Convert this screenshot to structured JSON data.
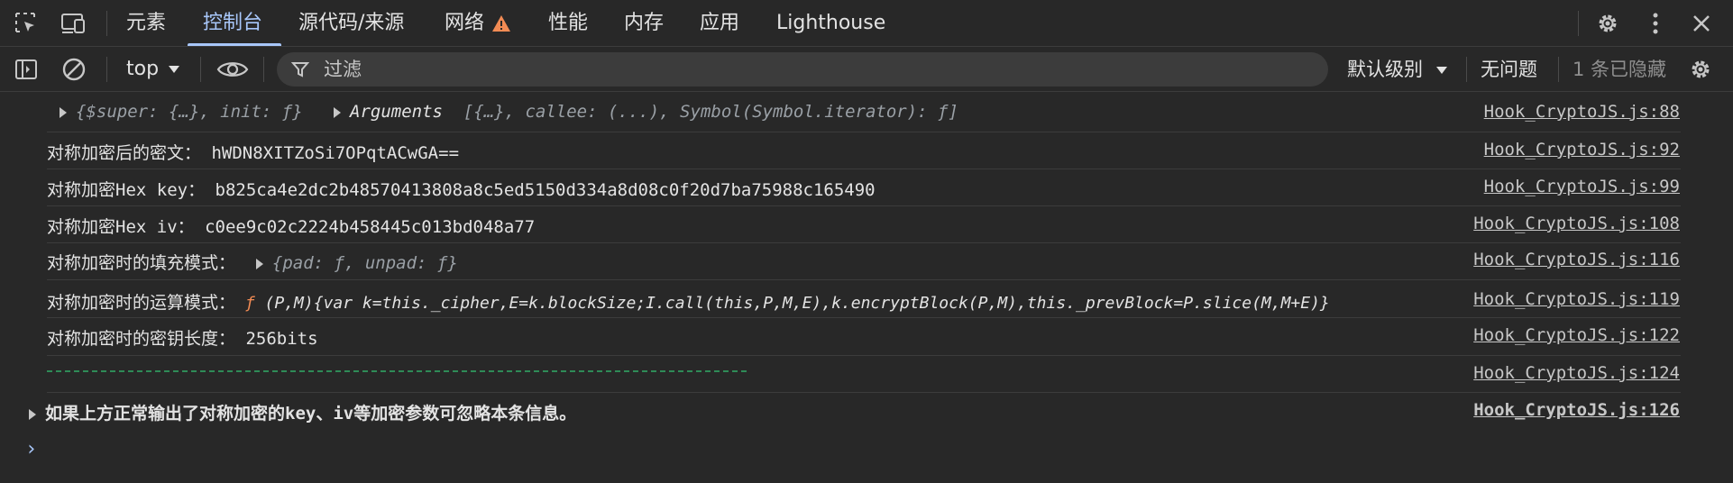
{
  "tabs": [
    {
      "label": "元素"
    },
    {
      "label": "控制台"
    },
    {
      "label": "源代码/来源"
    },
    {
      "label": "网络"
    },
    {
      "label": "性能"
    },
    {
      "label": "内存"
    },
    {
      "label": "应用"
    },
    {
      "label": "Lighthouse"
    }
  ],
  "toolbar": {
    "context": "top",
    "filter_placeholder": "过滤",
    "levels": "默认级别",
    "issues": "无问题",
    "hidden_count": "1 条已隐藏"
  },
  "colors": {
    "accent": "#a8c7fa",
    "background": "#282828",
    "warning": "#f28b54",
    "dashes": "#2e8b57"
  },
  "messages": [
    {
      "obj1": "{$super: {…}, init: ƒ}",
      "args_label": "Arguments",
      "args_detail": "[{…}, callee: (...), Symbol(Symbol.iterator): ƒ]",
      "source": "Hook_CryptoJS.js:88"
    },
    {
      "label": "对称加密后的密文：",
      "value": "hWDN8XITZoSi7OPqtACwGA==",
      "source": "Hook_CryptoJS.js:92"
    },
    {
      "label": "对称加密Hex key：",
      "value": "b825ca4e2dc2b48570413808a8c5ed5150d334a8d08c0f20d7ba75988c165490",
      "source": "Hook_CryptoJS.js:99"
    },
    {
      "label": "对称加密Hex iv：",
      "value": "c0ee9c02c2224b458445c013bd048a77",
      "source": "Hook_CryptoJS.js:108"
    },
    {
      "label": "对称加密时的填充模式：",
      "value": "{pad: ƒ, unpad: ƒ}",
      "source": "Hook_CryptoJS.js:116"
    },
    {
      "label": "对称加密时的运算模式：",
      "fn": "ƒ",
      "value": "(P,M){var k=this._cipher,E=k.blockSize;I.call(this,P,M,E),k.encryptBlock(P,M),this._prevBlock=P.slice(M,M+E)}",
      "source": "Hook_CryptoJS.js:119"
    },
    {
      "label": "对称加密时的密钥长度：",
      "value": "256bits",
      "source": "Hook_CryptoJS.js:122"
    },
    {
      "source": "Hook_CryptoJS.js:124"
    },
    {
      "label": "如果上方正常输出了对称加密的key、iv等加密参数可忽略本条信息。",
      "source": "Hook_CryptoJS.js:126"
    }
  ],
  "prompt": "›"
}
